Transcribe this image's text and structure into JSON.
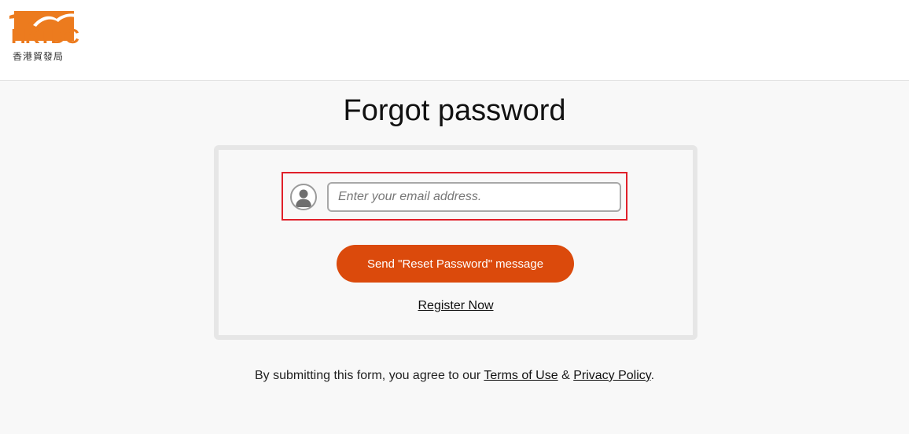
{
  "header": {
    "logo_text": "HKTDC",
    "logo_subtext": "香港貿發局"
  },
  "page_title": "Forgot password",
  "form": {
    "email_placeholder": "Enter your email address.",
    "email_value": "",
    "send_button_label": "Send \"Reset Password\" message",
    "register_link_label": "Register Now"
  },
  "footer": {
    "agreement_prefix": "By submitting this form, you agree to our ",
    "terms_label": "Terms of Use",
    "ampersand": " & ",
    "privacy_label": "Privacy Policy",
    "agreement_suffix": "."
  },
  "colors": {
    "brand_orange": "#ec7b1e",
    "button_orange": "#db4a0c",
    "highlight_red": "#e0202a"
  },
  "icons": {
    "avatar": "user-avatar-icon"
  }
}
